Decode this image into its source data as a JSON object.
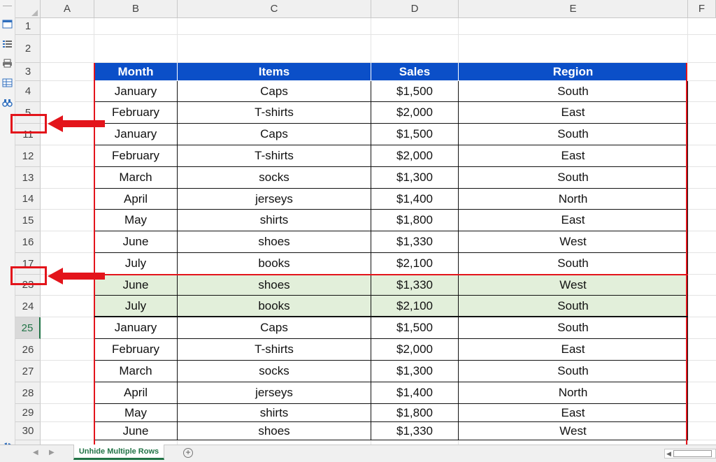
{
  "columns": [
    "A",
    "B",
    "C",
    "D",
    "E",
    "F"
  ],
  "row_numbers": [
    "1",
    "2",
    "3",
    "4",
    "5",
    "11",
    "12",
    "13",
    "14",
    "15",
    "16",
    "17",
    "23",
    "24",
    "25",
    "26",
    "27",
    "28",
    "29",
    "30"
  ],
  "table": {
    "headers": [
      "Month",
      "Items",
      "Sales",
      "Region"
    ],
    "rows": [
      [
        "January",
        "Caps",
        "$1,500",
        "South"
      ],
      [
        "February",
        "T-shirts",
        "$2,000",
        "East"
      ],
      [
        "January",
        "Caps",
        "$1,500",
        "South"
      ],
      [
        "February",
        "T-shirts",
        "$2,000",
        "East"
      ],
      [
        "March",
        "socks",
        "$1,300",
        "South"
      ],
      [
        "April",
        "jerseys",
        "$1,400",
        "North"
      ],
      [
        "May",
        "shirts",
        "$1,800",
        "East"
      ],
      [
        "June",
        "shoes",
        "$1,330",
        "West"
      ],
      [
        "July",
        "books",
        "$2,100",
        "South"
      ],
      [
        "June",
        "shoes",
        "$1,330",
        "West"
      ],
      [
        "July",
        "books",
        "$2,100",
        "South"
      ],
      [
        "January",
        "Caps",
        "$1,500",
        "South"
      ],
      [
        "February",
        "T-shirts",
        "$2,000",
        "East"
      ],
      [
        "March",
        "socks",
        "$1,300",
        "South"
      ],
      [
        "April",
        "jerseys",
        "$1,400",
        "North"
      ],
      [
        "May",
        "shirts",
        "$1,800",
        "East"
      ],
      [
        "June",
        "shoes",
        "$1,330",
        "West"
      ]
    ]
  },
  "sheet_tab": "Unhide Multiple Rows",
  "colors": {
    "header_fill": "#0b4fc8",
    "highlight_fill": "#e2efda",
    "annotation": "#e3141b",
    "excel_green": "#217346"
  },
  "icons": [
    "sheet-view-icon",
    "list-icon",
    "print-icon",
    "table-icon",
    "binoculars-icon",
    "settings-gear-icon",
    "add-sheet-icon"
  ]
}
